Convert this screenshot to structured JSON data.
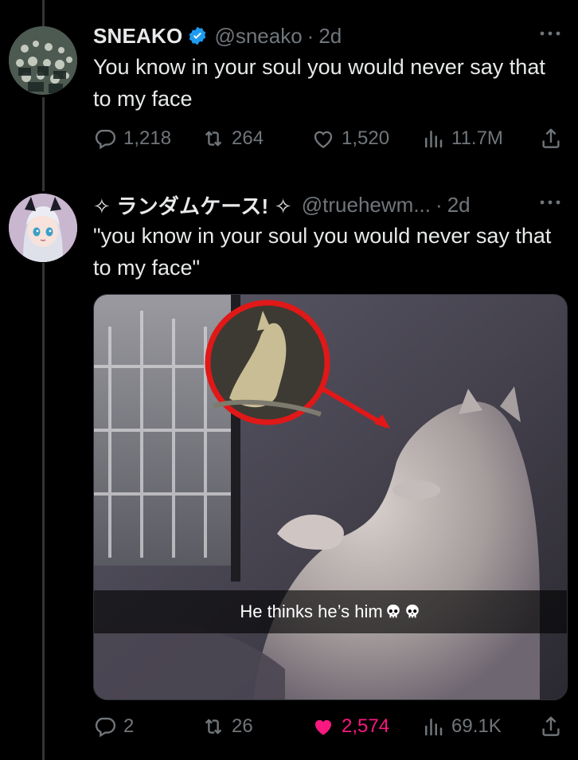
{
  "tweets": [
    {
      "author_name": "SNEAKO",
      "verified": true,
      "handle": "@sneako",
      "separator": "·",
      "time": "2d",
      "text": "You know in your soul you would never say that to my face",
      "replies": "1,218",
      "reposts": "264",
      "likes": "1,520",
      "views": "11.7M",
      "liked": false
    },
    {
      "author_name": "✧ ランダムケース! ✧",
      "verified": false,
      "handle": "@truehewm...",
      "separator": "·",
      "time": "2d",
      "text": "\"you know in your soul you would never say that to my face\"",
      "media_caption": "He thinks he’s him",
      "media_emoji": "💀💀",
      "replies": "2",
      "reposts": "26",
      "likes": "2,574",
      "views": "69.1K",
      "liked": true
    }
  ],
  "colors": {
    "background": "#000000",
    "text_primary": "#e7e9ea",
    "text_secondary": "#71767b",
    "verified_blue": "#1d9bf0",
    "like_pink": "#f91880",
    "thread_line": "#333639"
  },
  "icons": [
    "reply-icon",
    "repost-icon",
    "like-icon",
    "views-icon",
    "share-icon",
    "more-icon",
    "verified-badge-icon"
  ]
}
